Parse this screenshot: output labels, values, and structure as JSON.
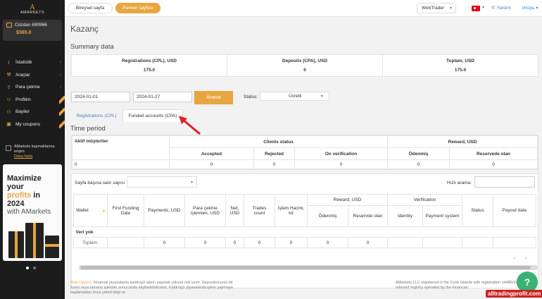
{
  "sidebar": {
    "logo_mark": "A",
    "logo_text": "AMARKETS",
    "wallet_label": "Cüzdan 690966",
    "wallet_balance": "$365.0",
    "items": [
      {
        "label": "İstatistik",
        "icon": "stats-icon",
        "chevron": true
      },
      {
        "label": "Araçlar",
        "icon": "tools-icon",
        "chevron": true
      },
      {
        "label": "Para çekme",
        "icon": "withdraw-icon",
        "chevron": true
      },
      {
        "label": "Profilim",
        "icon": "profile-icon",
        "chevron": false
      },
      {
        "label": "Bayiler",
        "icon": "dealers-icon",
        "chevron": false
      },
      {
        "label": "My coupons",
        "icon": "coupon-icon",
        "chevron": false
      }
    ],
    "warning_text": "AMarkets kaymaklarına erişim",
    "warning_link": "Daha fazla",
    "banner": {
      "line1": "Maximize your",
      "line2_orange": "profits",
      "line2_rest": " in 2024",
      "line3": "with AMarkets"
    }
  },
  "topbar": {
    "tab_individual": "Bireysel sayfa",
    "tab_partner": "Partner sayfası",
    "webtrader": "WebTrader",
    "help": "Yardım",
    "user": "Игорь"
  },
  "page": {
    "title": "Kazanç",
    "summary_title": "Summary data",
    "summary": [
      {
        "header": "Registrations (CPL), USD",
        "value": "175.0"
      },
      {
        "header": "Deposits (CPA), USD",
        "value": "0"
      },
      {
        "header": "Toplam, USD",
        "value": "175.0"
      }
    ],
    "filter": {
      "date_from": "2024-01-01",
      "date_to": "2024-01-27",
      "search_button": "Arama",
      "status_label": "Status:",
      "status_value": "Ücretli"
    },
    "tabs": {
      "cpl": "Registrations (CPL)",
      "cpa": "Funded accounts (CPA)"
    },
    "time_period_title": "Time period",
    "period_table": {
      "active_clients": "Aktif müşteriler",
      "clients_status": "Clients status",
      "reward": "Reward, USD",
      "accepted": "Accepted",
      "rejected": "Rejected",
      "on_verification": "On verification",
      "paid": "Ödenmiş",
      "reserved": "Reservede olan",
      "values": [
        "0",
        "0",
        "0",
        "0",
        "0",
        "0"
      ]
    },
    "rows_label": "Sayfa başına satır sayısı",
    "quick_search": "Hızlı arama:",
    "main_table": {
      "headers": {
        "wallet": "Wallet",
        "first_funding": "First Funding Date",
        "payments": "Payments, USD",
        "withdrawals": "Para çekme işlemleri, USD",
        "net": "Net, USD",
        "trades": "Trades count",
        "volume": "İşlem Hacmi, lot",
        "reward": "Reward, USD",
        "paid": "Ödenmiş",
        "reserved": "Reservde olan",
        "verification": "Verification",
        "identity": "Identity",
        "payment_system": "Payment system",
        "status": "Status",
        "payout": "Payout date"
      },
      "no_data": "Veri yok",
      "total_label": "Toplam:",
      "totals": [
        "0",
        "0",
        "0",
        "0",
        "0",
        "0",
        "0"
      ]
    },
    "footer_left_risk": "Risk Uyarısı:",
    "footer_left": " Finansal piyasalarda kaldıraçlı işlem yapmak yüksek risk içerir. Depozitonuzun bir kısmı veya tamamı işlemler sonucunda kaybedebilirsiniz. Kaldıraçlı piyasalarda işlem yapmaya başlamadan önce yeterli bilgi ve",
    "footer_right": "AMarkets LLC registered in the Cook Islands with registration 14486/2023 and the relevant registry operated by the Financial",
    "watermark": "alltradingprofit.com"
  },
  "colors": {
    "accent": "#e8a640",
    "link": "#4a7fc1",
    "sidebar": "#1c1c1c",
    "chat": "#3bb273"
  }
}
